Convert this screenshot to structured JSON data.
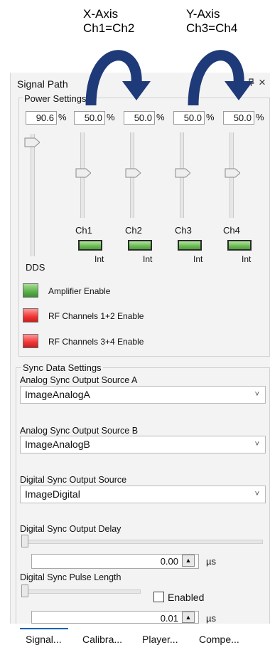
{
  "annotations": {
    "x_axis_line1": "X-Axis",
    "x_axis_line2": "Ch1=Ch2",
    "y_axis_line1": "Y-Axis",
    "y_axis_line2": "Ch3=Ch4"
  },
  "window": {
    "title": "Signal Path",
    "pin_icon": "pin-icon",
    "close_glyph": "×"
  },
  "power": {
    "group_label": "Power Settings",
    "percent_symbol": "%",
    "dds": {
      "value": "90.6",
      "label": "DDS"
    },
    "channels": [
      {
        "value": "50.0",
        "label": "Ch1",
        "int_label": "Int"
      },
      {
        "value": "50.0",
        "label": "Ch2",
        "int_label": "Int"
      },
      {
        "value": "50.0",
        "label": "Ch3",
        "int_label": "Int"
      },
      {
        "value": "50.0",
        "label": "Ch4",
        "int_label": "Int"
      }
    ],
    "amp_enable": "Amplifier Enable",
    "rf12_enable": "RF Channels 1+2 Enable",
    "rf34_enable": "RF Channels 3+4 Enable",
    "colors": {
      "green": "#5bb04a",
      "red": "#f03535"
    }
  },
  "sync": {
    "group_label": "Sync Data Settings",
    "source_a": {
      "label": "Analog Sync Output Source A",
      "value": "ImageAnalogA"
    },
    "source_b": {
      "label": "Analog Sync Output Source B",
      "value": "ImageAnalogB"
    },
    "digital_source": {
      "label": "Digital Sync Output Source",
      "value": "ImageDigital"
    },
    "delay": {
      "label": "Digital Sync Output Delay",
      "value": "0.00",
      "unit": "µs"
    },
    "pulse": {
      "label": "Digital Sync Pulse Length",
      "value": "0.01",
      "unit": "µs",
      "enabled_label": "Enabled"
    },
    "chevron": "˅"
  },
  "tabs": [
    "Signal...",
    "Calibra...",
    "Player...",
    "Compe..."
  ],
  "accent": "#0063b1"
}
